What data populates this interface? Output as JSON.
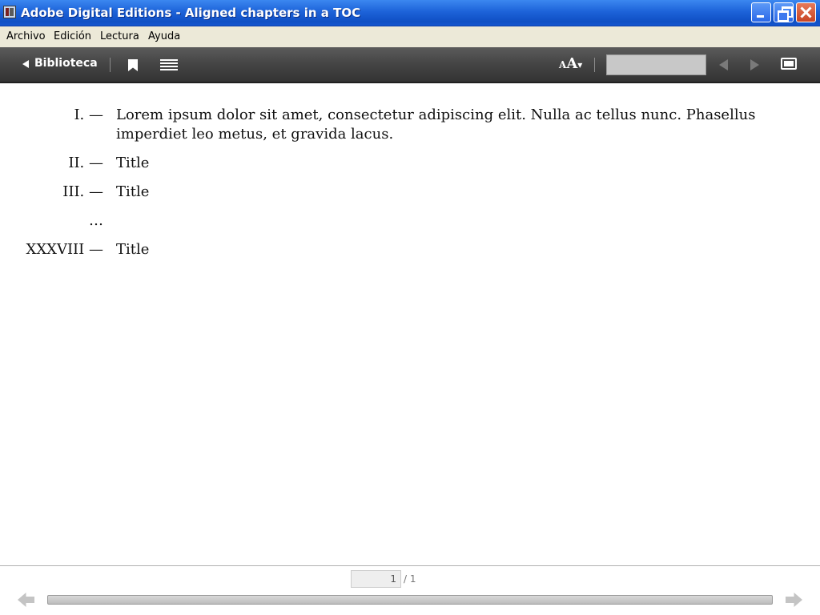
{
  "window": {
    "title": "Adobe Digital Editions - Aligned chapters in a TOC"
  },
  "menu": [
    "Archivo",
    "Edición",
    "Lectura",
    "Ayuda"
  ],
  "toolbar": {
    "library_label": "Biblioteca",
    "font_icon_large": "A",
    "font_icon_small": "A",
    "search_value": "",
    "icons": [
      "back-arrow-icon",
      "bookmark-icon",
      "toc-list-icon",
      "font-size-icon",
      "prev-page-icon",
      "next-page-icon",
      "fullscreen-icon"
    ]
  },
  "toc": [
    {
      "num": "I. —",
      "title": "Lorem ipsum dolor sit amet, consectetur adipiscing elit. Nulla ac tellus nunc. Phasellus imperdiet leo metus, et gravida lacus."
    },
    {
      "num": "II. —",
      "title": "Title"
    },
    {
      "num": "III. —",
      "title": "Title"
    },
    {
      "num": "…",
      "title": ""
    },
    {
      "num": "XXXVIII —",
      "title": "Title"
    }
  ],
  "pagination": {
    "current": "1",
    "total": "/ 1"
  },
  "reading_progress": 0
}
